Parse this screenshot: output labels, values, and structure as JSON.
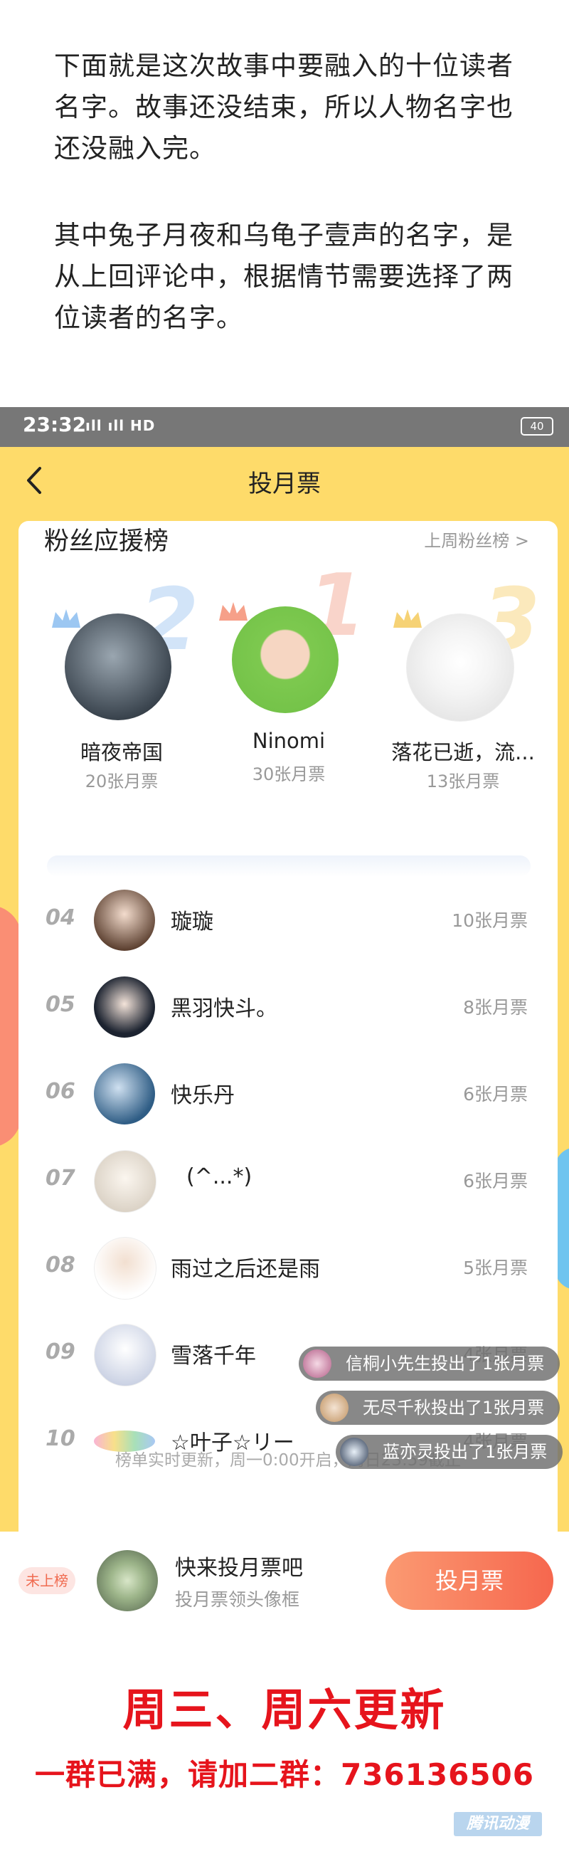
{
  "intro": {
    "paragraph1": "下面就是这次故事中要融入的十位读者名字。故事还没结束，所以人物名字也还没融入完。",
    "paragraph2": "其中兔子月夜和乌龟子壹声的名字，是从上回评论中，根据情节需要选择了两位读者的名字。"
  },
  "status_bar": {
    "time": "23:32",
    "signal": "ıll ıll HD",
    "battery": "40"
  },
  "header": {
    "title": "投月票"
  },
  "fans": {
    "section_title": "粉丝应援榜",
    "last_week_link": "上周粉丝榜 >"
  },
  "podium": [
    {
      "rank": "2",
      "name": "暗夜帝国",
      "tickets": "20张月票",
      "color": "#7fb4ec"
    },
    {
      "rank": "1",
      "name": "Ninomi",
      "tickets": "30张月票",
      "color": "#f0866a"
    },
    {
      "rank": "3",
      "name": "落花已逝，流...",
      "tickets": "13张月票",
      "color": "#f5c342"
    }
  ],
  "ranking": [
    {
      "rank": "04",
      "name": "璇璇",
      "tickets": "10张月票"
    },
    {
      "rank": "05",
      "name": "黑羽快斗。",
      "tickets": "8张月票"
    },
    {
      "rank": "06",
      "name": "快乐丹",
      "tickets": "6张月票"
    },
    {
      "rank": "07",
      "name": "(^...*)",
      "tickets": "6张月票"
    },
    {
      "rank": "08",
      "name": "雨过之后还是雨",
      "tickets": "5张月票"
    },
    {
      "rank": "09",
      "name": "雪落千年",
      "tickets": "4张月票"
    },
    {
      "rank": "10",
      "name": "☆叶子☆リー",
      "tickets": "4张月票"
    }
  ],
  "toasts": [
    "信桐小先生投出了1张月票",
    "无尽千秋投出了1张月票",
    "蓝亦灵投出了1张月票"
  ],
  "footnote": "榜单实时更新，周一0:00开启，周日23:59截止",
  "bottom_bar": {
    "badge": "未上榜",
    "title": "快来投月票吧",
    "subtitle": "投月票领头像框",
    "vote_button": "投月票"
  },
  "outro": {
    "line1": "周三、周六更新",
    "line2": "一群已满，请加二群：736136506",
    "watermark": "腾讯动漫"
  }
}
